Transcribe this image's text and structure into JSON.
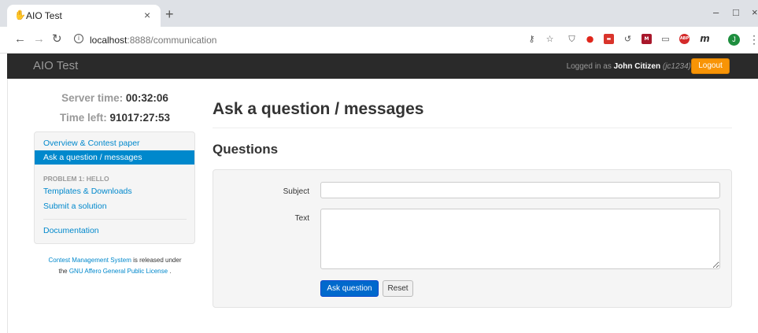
{
  "browser": {
    "tab_title": "AIO Test",
    "tab_close": "×",
    "new_tab": "+",
    "url_host": "localhost",
    "url_path": ":8888/communication",
    "window_min": "–",
    "window_max": "□",
    "window_close": "×",
    "profile_initial": "J",
    "ext_m": "m",
    "ext_abp": "ABP"
  },
  "app": {
    "brand": "AIO Test",
    "login_prefix": "Logged in as ",
    "user_name": "John Citizen",
    "user_id": "(jc1234)",
    "logout_label": "Logout"
  },
  "sidebar": {
    "server_time_label": "Server time: ",
    "server_time": "00:32:06",
    "time_left_label": "Time left: ",
    "time_left": "91017:27:53",
    "nav": {
      "overview": "Overview & Contest paper",
      "ask": "Ask a question / messages",
      "problem_header": "Problem 1: Hello",
      "templates": "Templates & Downloads",
      "submit": "Submit a solution",
      "documentation": "Documentation"
    },
    "license": {
      "cms_link": "Contest Management System",
      "text_mid": " is released under",
      "the": "the ",
      "gpl_link": "GNU Affero General Public License",
      "end": " ."
    }
  },
  "main": {
    "title": "Ask a question / messages",
    "questions_heading": "Questions",
    "subject_label": "Subject",
    "text_label": "Text",
    "subject_value": "",
    "text_value": "",
    "ask_button": "Ask question",
    "reset_button": "Reset"
  },
  "colors": {
    "accent": "#0088cc",
    "logout": "#f89406",
    "navbar": "#2a2a2a"
  }
}
